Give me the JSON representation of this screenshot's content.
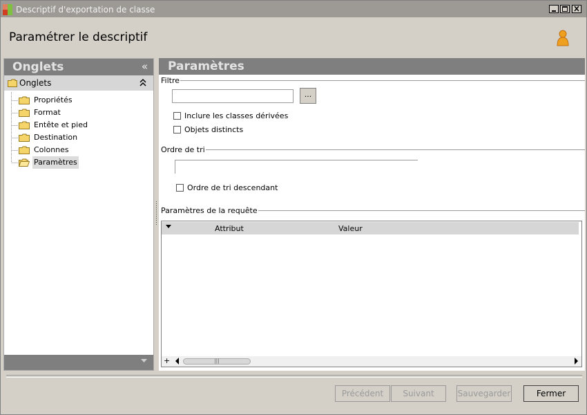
{
  "window": {
    "title": "Descriptif d'exportation de classe"
  },
  "header": {
    "title": "Paramétrer le descriptif"
  },
  "sidebar": {
    "title": "Onglets",
    "collapse_glyph": "«",
    "group_label": "Onglets",
    "group_arrow": "⌃",
    "items": [
      {
        "label": "Propriétés",
        "icon": "folder-icon"
      },
      {
        "label": "Format",
        "icon": "folder-icon"
      },
      {
        "label": "Entête et pied",
        "icon": "folder-icon"
      },
      {
        "label": "Destination",
        "icon": "folder-icon"
      },
      {
        "label": "Colonnes",
        "icon": "folder-icon"
      },
      {
        "label": "Paramètres",
        "icon": "folder-open-icon",
        "selected": true
      }
    ]
  },
  "main": {
    "title": "Paramètres",
    "filter": {
      "legend": "Filtre",
      "value": "",
      "browse_label": "...",
      "include_derived_label": "Inclure les classes dérivées",
      "include_derived_checked": false,
      "distinct_objects_label": "Objets distincts",
      "distinct_objects_checked": false
    },
    "sort": {
      "legend": "Ordre de tri",
      "value": "",
      "descending_label": "Ordre de tri descendant",
      "descending_checked": false
    },
    "query_params": {
      "legend": "Paramètres de la requête",
      "columns": [
        "Attribut",
        "Valeur"
      ],
      "rows": []
    }
  },
  "footer": {
    "buttons": [
      {
        "label": "Précédent",
        "enabled": false
      },
      {
        "label": "Suivant",
        "enabled": false
      },
      {
        "label": "Sauvegarder",
        "enabled": false
      },
      {
        "label": "Fermer",
        "enabled": true
      }
    ]
  },
  "colors": {
    "panel_header": "#7f7f7f",
    "titlebar": "#9d9a95",
    "window_bg": "#d4d0c8",
    "user_icon": "#f0a020"
  }
}
